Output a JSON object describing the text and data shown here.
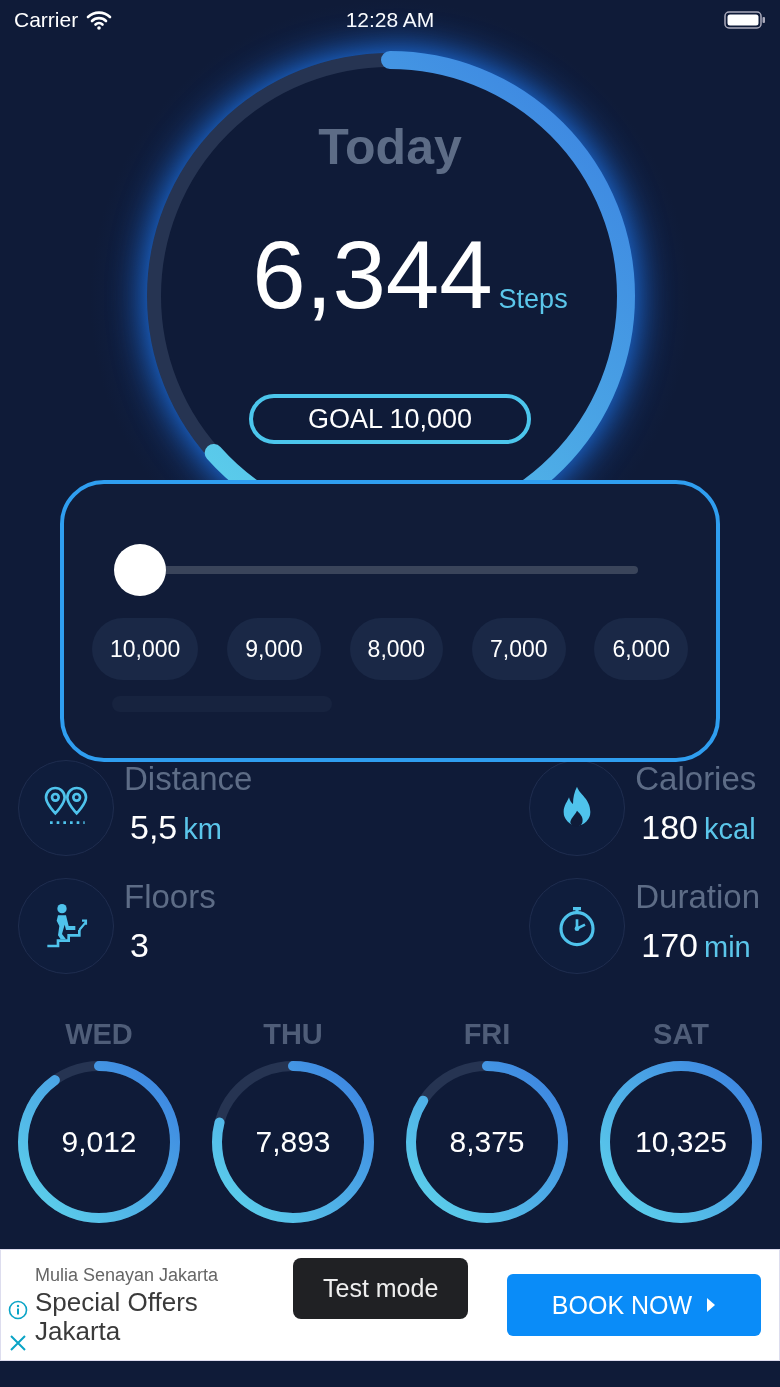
{
  "status_bar": {
    "carrier": "Carrier",
    "time": "12:28 AM"
  },
  "today": {
    "title": "Today",
    "steps": "6,344",
    "unit": "Steps",
    "goal": "GOAL 10,000"
  },
  "goal_picker": {
    "level": 0,
    "options": [
      "10,000",
      "9,000",
      "8,000",
      "7,000",
      "6,000"
    ]
  },
  "stats": [
    {
      "label": "Distance",
      "value": "5,5",
      "unit": "km"
    },
    {
      "label": "Calories",
      "value": "180",
      "unit": "kcal"
    },
    {
      "label": "Floors",
      "value": "3"
    },
    {
      "label": "Duration",
      "value": "170",
      "unit": "min"
    }
  ],
  "days": [
    {
      "day": "WED",
      "steps": "9,012",
      "level": 0.9
    },
    {
      "day": "THU",
      "steps": "7,893",
      "level": 0.79
    },
    {
      "day": "FRI",
      "steps": "8,375",
      "level": 0.84
    },
    {
      "day": "SAT",
      "steps": "10,325",
      "level": 1
    }
  ],
  "ad": {
    "advertiser": "Mulia Senayan Jakarta",
    "headline": "Special Offers Jakarta",
    "badge": "Test mode",
    "button": "BOOK NOW"
  }
}
